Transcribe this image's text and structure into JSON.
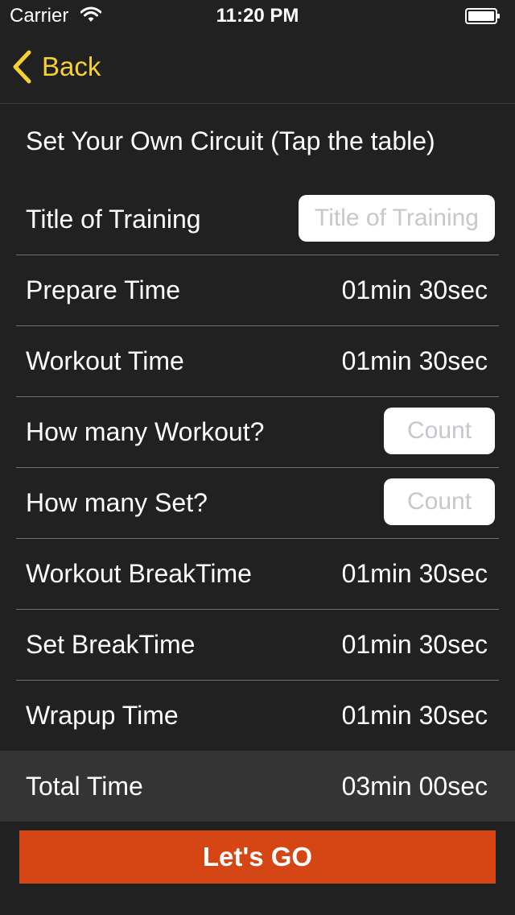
{
  "status": {
    "carrier": "Carrier",
    "time": "11:20 PM"
  },
  "nav": {
    "back_label": "Back"
  },
  "heading": "Set Your Own Circuit (Tap the table)",
  "rows": [
    {
      "label": "Title of Training",
      "placeholder": "Title of Training"
    },
    {
      "label": "Prepare Time",
      "value": "01min 30sec"
    },
    {
      "label": "Workout Time",
      "value": "01min 30sec"
    },
    {
      "label": "How many Workout?",
      "placeholder": "Count"
    },
    {
      "label": "How many Set?",
      "placeholder": "Count"
    },
    {
      "label": "Workout BreakTime",
      "value": "01min 30sec"
    },
    {
      "label": "Set BreakTime",
      "value": "01min 30sec"
    },
    {
      "label": "Wrapup Time",
      "value": "01min 30sec"
    }
  ],
  "total": {
    "label": "Total Time",
    "value": "03min 00sec"
  },
  "go_button": "Let's GO",
  "colors": {
    "accent": "#f7d22e",
    "button": "#d64614",
    "background": "#212121"
  }
}
